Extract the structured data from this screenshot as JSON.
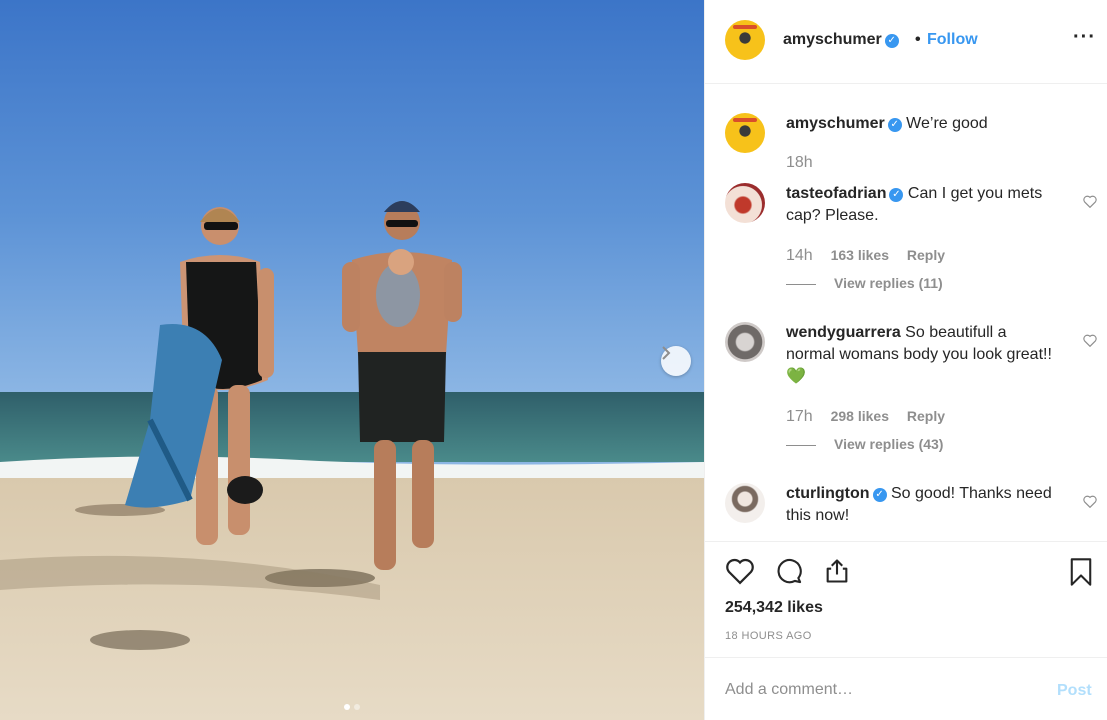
{
  "post": {
    "username": "amyschumer",
    "follow_label": "Follow",
    "bullet": "•",
    "more": "···"
  },
  "caption": {
    "username": "amyschumer",
    "text": "We’re good",
    "time": "18h"
  },
  "comments": [
    {
      "username": "tasteofadrian",
      "verified": true,
      "text": "Can I get you mets cap? Please.",
      "time": "14h",
      "likes": "163 likes",
      "reply": "Reply",
      "view_replies": "View replies (11)"
    },
    {
      "username": "wendyguarrera",
      "verified": false,
      "text": "So beautifull a normal womans body you look great!!💚",
      "time": "17h",
      "likes": "298 likes",
      "reply": "Reply",
      "view_replies": "View replies (43)"
    },
    {
      "username": "cturlington",
      "verified": true,
      "text": "So good! Thanks need this now!"
    }
  ],
  "actions": {
    "likes": "254,342 likes",
    "time_ago": "18 HOURS AGO"
  },
  "add_comment": {
    "placeholder": "Add a comment…",
    "post_label": "Post"
  },
  "colors": {
    "accent": "#3897f0",
    "post_disabled": "#b2dffc",
    "muted": "#8e8e8e"
  },
  "icons": [
    "verified-badge-icon",
    "more-options-icon",
    "heart-icon",
    "comment-icon",
    "share-icon",
    "bookmark-icon",
    "next-arrow-icon"
  ]
}
